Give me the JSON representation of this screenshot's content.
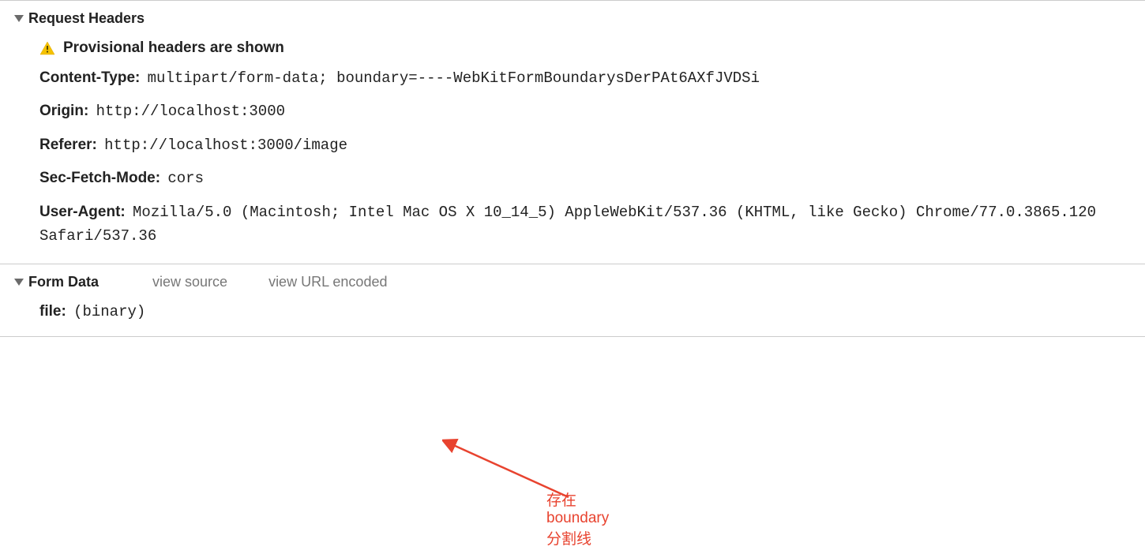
{
  "request_headers": {
    "title": "Request Headers",
    "warning": "Provisional headers are shown",
    "items": [
      {
        "key": "Content-Type:",
        "value": "multipart/form-data; boundary=----WebKitFormBoundarysDerPAt6AXfJVDSi"
      },
      {
        "key": "Origin:",
        "value": "http://localhost:3000"
      },
      {
        "key": "Referer:",
        "value": "http://localhost:3000/image"
      },
      {
        "key": "Sec-Fetch-Mode:",
        "value": "cors"
      },
      {
        "key": "User-Agent:",
        "value": "Mozilla/5.0 (Macintosh; Intel Mac OS X 10_14_5) AppleWebKit/537.36 (KHTML, like Gecko) Chrome/77.0.3865.120 Safari/537.36"
      }
    ]
  },
  "form_data": {
    "title": "Form Data",
    "view_source": "view source",
    "view_url_encoded": "view URL encoded",
    "items": [
      {
        "key": "file:",
        "value": "(binary)"
      }
    ]
  },
  "annotation": {
    "text": "存在boundary分割线",
    "color": "#e8432f"
  }
}
